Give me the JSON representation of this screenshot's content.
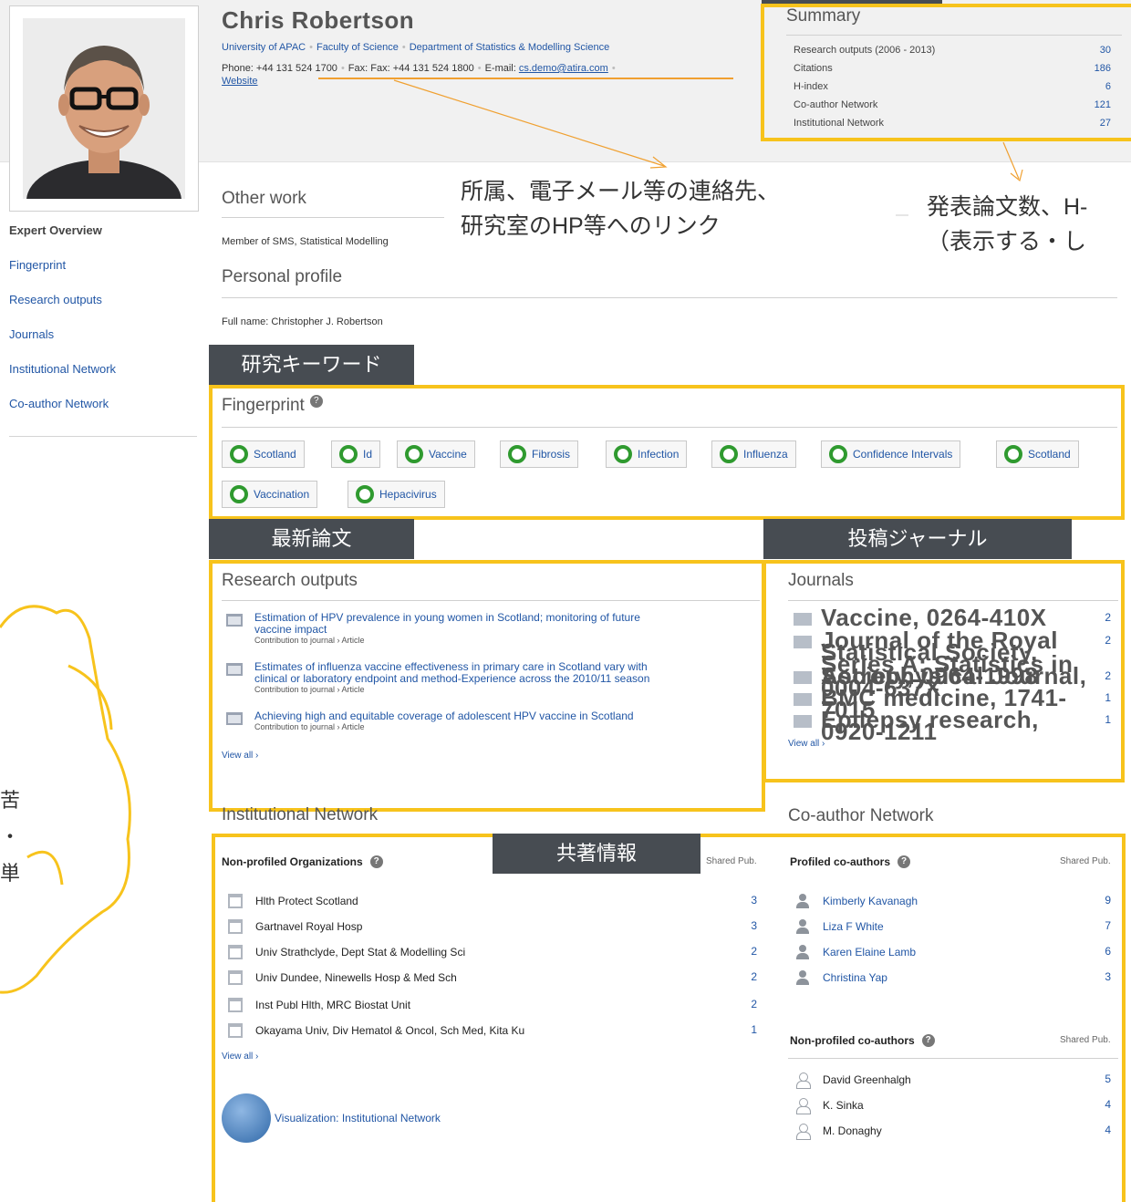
{
  "profile": {
    "name": "Chris Robertson",
    "affiliations": [
      "University of APAC",
      "Faculty of Science",
      "Department of Statistics & Modelling Science"
    ],
    "phone": "Phone: +44 131 524 1700",
    "fax": "Fax: Fax: +44 131 524 1800",
    "email_label": "E-mail:",
    "email": "cs.demo@atira.com",
    "website": "Website"
  },
  "summary": {
    "title": "Summary",
    "rows": [
      {
        "label": "Research outputs (2006 - 2013)",
        "value": "30"
      },
      {
        "label": "Citations",
        "value": "186"
      },
      {
        "label": "H-index",
        "value": "6"
      },
      {
        "label": "Co-author Network",
        "value": "121"
      },
      {
        "label": "Institutional Network",
        "value": "27"
      }
    ]
  },
  "nav": {
    "items": [
      "Expert Overview",
      "Fingerprint",
      "Research outputs",
      "Journals",
      "Institutional Network",
      "Co-author Network"
    ]
  },
  "other_work": {
    "title": "Other work",
    "text": "Member of SMS, Statistical Modelling"
  },
  "personal_profile": {
    "title": "Personal profile",
    "text": "Full name: Christopher J. Robertson"
  },
  "callouts": {
    "contact_line1": "所属、電子メール等の連絡先、",
    "contact_line2": "研究室のHP等へのリンク",
    "summary_line1": "発表論文数、H-",
    "summary_line2": "（表示する・し",
    "left_cloud": [
      "苦",
      "・",
      "単"
    ]
  },
  "labels": {
    "keywords": "研究キーワード",
    "latest_papers": "最新論文",
    "journals": "投稿ジャーナル",
    "coauthor_info": "共著情報"
  },
  "fingerprint": {
    "title": "Fingerprint",
    "help": "?",
    "chips": [
      "Scotland",
      "Id",
      "Vaccine",
      "Fibrosis",
      "Infection",
      "Influenza",
      "Confidence Intervals",
      "Scotland",
      "Vaccination",
      "Hepacivirus"
    ]
  },
  "research_outputs": {
    "title": "Research outputs",
    "items": [
      {
        "title_line1": "Estimation of HPV prevalence in young women in Scotland; monitoring of future",
        "title_line2": "vaccine impact",
        "sub": "Contribution to journal › Article"
      },
      {
        "title_line1": "Estimates of influenza vaccine effectiveness in primary care in Scotland vary with",
        "title_line2": "clinical or laboratory endpoint and method-Experience across the 2010/11 season",
        "sub": "Contribution to journal › Article"
      },
      {
        "title_line1": "Achieving high and equitable coverage of adolescent HPV vaccine in Scotland",
        "title_line2": "",
        "sub": "Contribution to journal › Article"
      }
    ],
    "view_all": "View all ›"
  },
  "journals": {
    "title": "Journals",
    "items": [
      {
        "line1": "Vaccine, 0264-410X",
        "line2": "",
        "count": "2"
      },
      {
        "line1": "Journal of the Royal Statistical Society.",
        "line2": "Series A: Statistics in Society, 0964-1998",
        "count": "2"
      },
      {
        "line1": "Astrophysical Journal, 0004-637X",
        "line2": "",
        "count": "2"
      },
      {
        "line1": "BMC medicine, 1741-7015",
        "line2": "",
        "count": "1"
      },
      {
        "line1": "Epilepsy research, 0920-1211",
        "line2": "",
        "count": "1"
      }
    ],
    "view_all": "View all ›"
  },
  "institutional_network": {
    "title": "Institutional Network",
    "head": "Non-profiled Organizations",
    "shared": "Shared Pub.",
    "items": [
      {
        "name": "Hlth Protect Scotland",
        "count": "3"
      },
      {
        "name": "Gartnavel Royal Hosp",
        "count": "3"
      },
      {
        "name": "Univ Strathclyde, Dept Stat & Modelling Sci",
        "count": "2"
      },
      {
        "name": "Univ Dundee, Ninewells Hosp & Med Sch",
        "count": "2"
      },
      {
        "name": "Inst Publ Hlth, MRC Biostat Unit",
        "count": "2"
      },
      {
        "name": "Okayama Univ, Div Hematol & Oncol, Sch Med, Kita Ku",
        "count": "1"
      }
    ],
    "view_all": "View all ›",
    "visualization": "Visualization: Institutional Network"
  },
  "coauthor_network": {
    "title": "Co-author Network",
    "profiled_head": "Profiled co-authors",
    "shared": "Shared Pub.",
    "profiled": [
      {
        "name": "Kimberly Kavanagh",
        "count": "9"
      },
      {
        "name": "Liza F White",
        "count": "7"
      },
      {
        "name": "Karen Elaine Lamb",
        "count": "6"
      },
      {
        "name": "Christina Yap",
        "count": "3"
      }
    ],
    "nonprofiled_head": "Non-profiled co-authors",
    "nonprofiled": [
      {
        "name": "David Greenhalgh",
        "count": "5"
      },
      {
        "name": "K. Sinka",
        "count": "4"
      },
      {
        "name": "M. Donaghy",
        "count": "4"
      }
    ]
  },
  "colors": {
    "highlight": "#f7c31c",
    "label_bg": "#474c52",
    "link": "#2156a5",
    "fingerprint_ring": "#2f9a2f"
  }
}
